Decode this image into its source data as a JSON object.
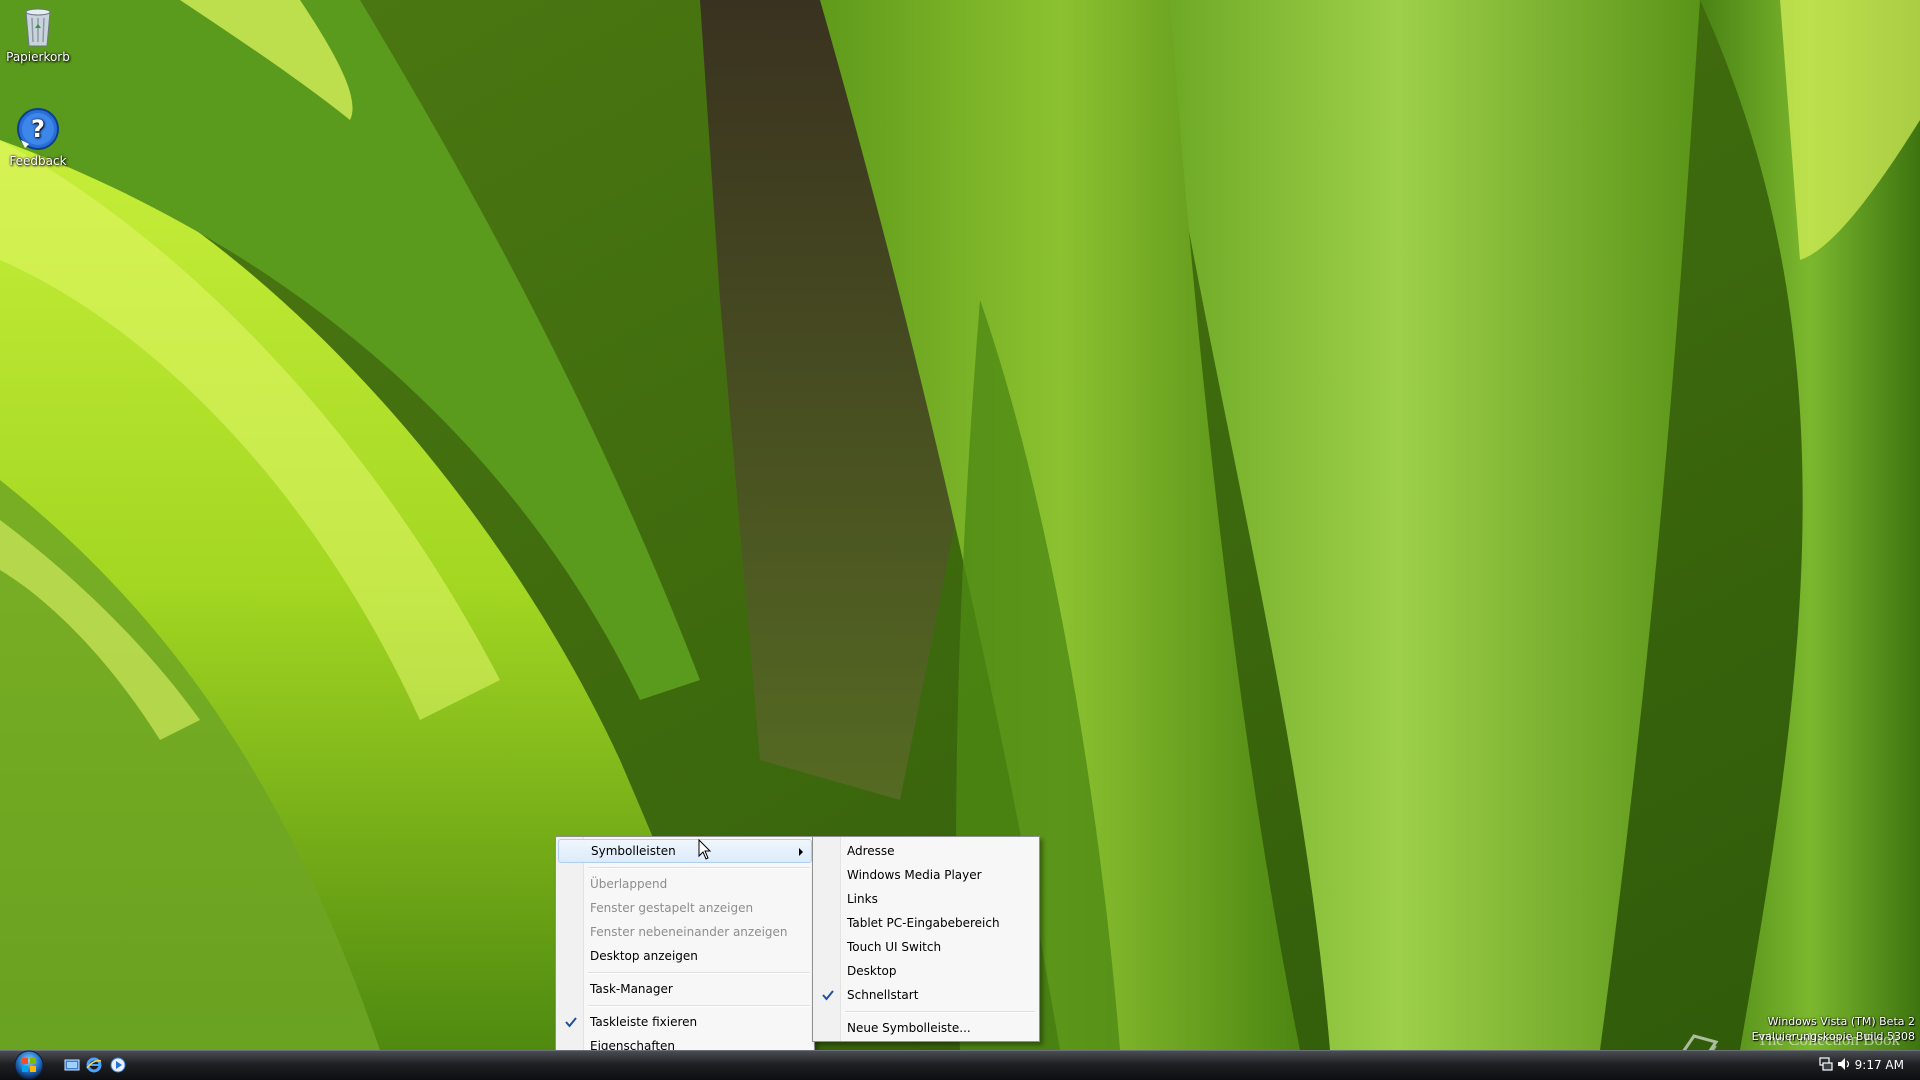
{
  "desktop": {
    "icons": [
      {
        "label": "Papierkorb",
        "icon": "recycle-bin-icon"
      },
      {
        "label": "Feedback",
        "icon": "help-question-icon"
      }
    ]
  },
  "context_menu": {
    "items": [
      {
        "label": "Symbolleisten",
        "state": "highlighted",
        "submenu": true
      },
      {
        "label": "Überlappend",
        "state": "disabled"
      },
      {
        "label": "Fenster gestapelt anzeigen",
        "state": "disabled"
      },
      {
        "label": "Fenster nebeneinander anzeigen",
        "state": "disabled"
      },
      {
        "label": "Desktop anzeigen",
        "state": "enabled"
      },
      {
        "label": "Task-Manager",
        "state": "enabled"
      },
      {
        "label": "Taskleiste fixieren",
        "state": "enabled",
        "checked": true
      },
      {
        "label": "Eigenschaften",
        "state": "enabled"
      }
    ]
  },
  "toolbars_submenu": {
    "items": [
      {
        "label": "Adresse"
      },
      {
        "label": "Windows Media Player"
      },
      {
        "label": "Links"
      },
      {
        "label": "Tablet PC-Eingabebereich"
      },
      {
        "label": "Touch UI Switch"
      },
      {
        "label": "Desktop"
      },
      {
        "label": "Schnellstart",
        "checked": true
      },
      {
        "label": "Neue Symbolleiste..."
      }
    ]
  },
  "taskbar": {
    "start_icon": "windows-start-orb-icon",
    "quick_launch": [
      "show-desktop-icon",
      "internet-explorer-icon",
      "media-player-icon"
    ],
    "tray_icons": [
      "network-icon",
      "volume-icon"
    ],
    "clock": "9:17 AM"
  },
  "watermark": {
    "build_line1": "Windows Vista (TM) Beta 2",
    "build_line2": "Evaluierungskopie Build 5308",
    "collection_text": "The Collection Book"
  },
  "colors": {
    "menu_background": "#f7f7f7",
    "menu_highlight": "#dcebfb",
    "menu_highlight_border": "#aecff7",
    "taskbar": "#1e2024",
    "check_color": "#1f4fa0"
  }
}
